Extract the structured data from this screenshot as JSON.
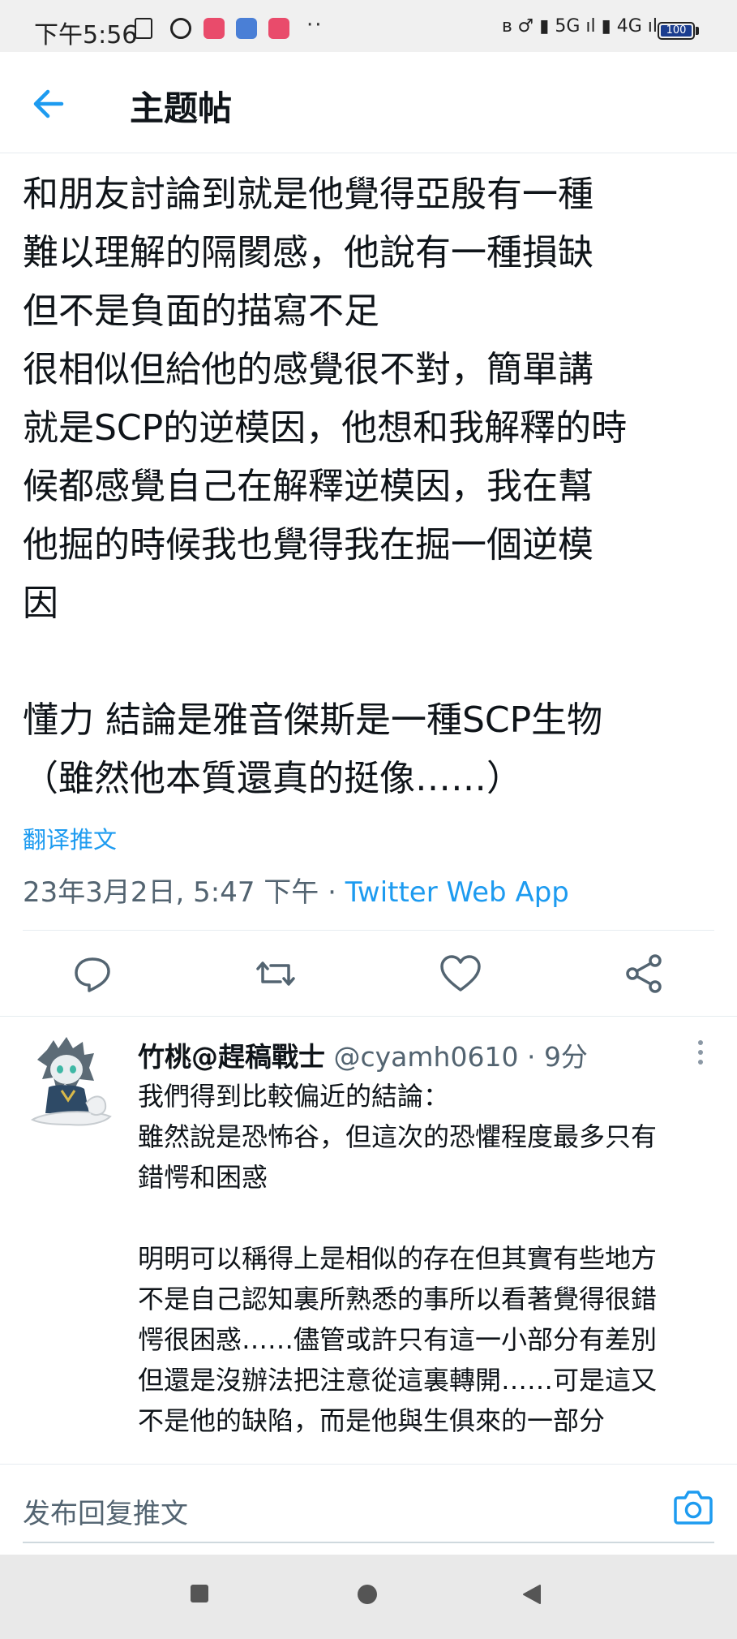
{
  "status_bar": {
    "time": "下午5:56",
    "network_icons_text": "ʙ ♂ ▮ 5G ıl ▮ 4G ıl",
    "battery_level_text": "100",
    "overflow": "··"
  },
  "header": {
    "title": "主题帖"
  },
  "tweet": {
    "text": "和朋友討論到就是他覺得亞殷有一種\n難以理解的隔閡感，他說有一種損缺\n但不是負面的描寫不足\n很相似但給他的感覺很不對，簡單講\n就是SCP的逆模因，他想和我解釋的時\n候都感覺自己在解釋逆模因，我在幫\n他掘的時候我也覺得我在掘一個逆模\n因\n\n懂力 結論是雅音傑斯是一種SCP生物\n（雖然他本質還真的挺像……）",
    "translate_label": "翻译推文",
    "timestamp": "23年3月2日, 5:47 下午",
    "separator": " · ",
    "source": "Twitter Web App"
  },
  "actions": {
    "reply_icon": "reply-icon",
    "retweet_icon": "retweet-icon",
    "like_icon": "like-icon",
    "share_icon": "share-icon"
  },
  "reply": {
    "name": "竹桃@趕稿戰士",
    "handle": "@cyamh0610",
    "separator": " · ",
    "time": "9分",
    "text": "我們得到比較偏近的結論：\n雖然說是恐怖谷，但這次的恐懼程度最多只有\n錯愕和困惑\n\n明明可以稱得上是相似的存在但其實有些地方\n不是自己認知裏所熟悉的事所以看著覺得很錯\n愕很困惑……儘管或許只有這一小部分有差別\n但還是沒辦法把注意從這裏轉開……可是這又\n不是他的缺陷，而是他與生俱來的一部分"
  },
  "compose": {
    "placeholder": "发布回复推文"
  },
  "colors": {
    "accent": "#1d9bf0",
    "text": "#0f1419",
    "muted": "#536471",
    "divider": "#e6ecf0",
    "navbar": "#e9e9e9"
  }
}
